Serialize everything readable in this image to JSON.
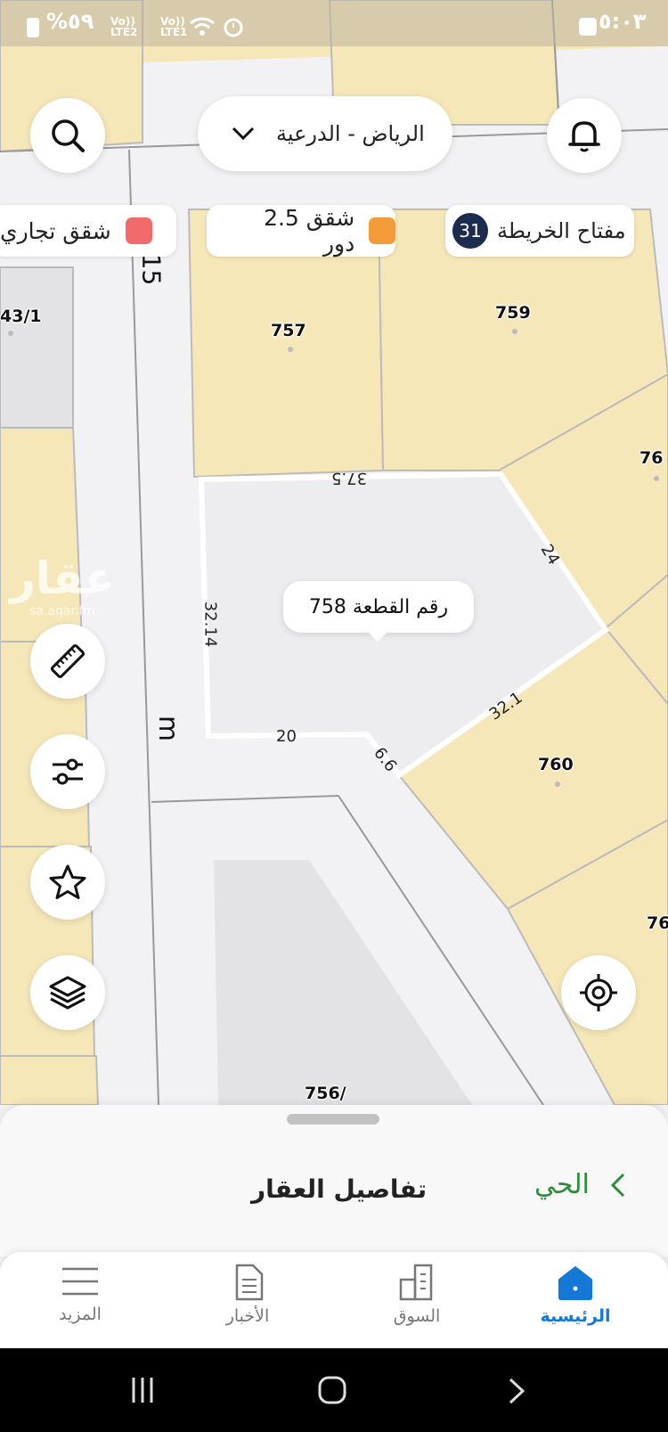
{
  "status_bar": {
    "time": "٥:٠٣",
    "battery": "%٥٩",
    "network_1": "Vo)) LTE2",
    "network_2": "Vo)) LTE1"
  },
  "header": {
    "location": "الرياض - الدرعية"
  },
  "legend_chips": {
    "map_key_label": "مفتاح الخريطة",
    "map_key_count": "31",
    "chip_1": {
      "label": "شقق 2.5 دور",
      "color": "#f29b38"
    },
    "chip_2": {
      "label": "شقق تجاري",
      "color": "#f26b6b"
    }
  },
  "map": {
    "street_labels": [
      "15",
      "m",
      "m"
    ],
    "plots": [
      "757",
      "759",
      "76",
      "760",
      "76",
      "756/",
      "43/1"
    ],
    "dimensions": [
      "37.5",
      "24",
      "32.14",
      "20",
      "6.6",
      "32.1"
    ],
    "selected_plot_label": "رقم القطعة 758",
    "watermark": "عقار",
    "watermark_sub": "sa.aqar.fm"
  },
  "bottom_sheet": {
    "title": "تفاصيل العقار",
    "link": "الحي"
  },
  "nav": {
    "home": "الرئيسية",
    "market": "السوق",
    "news": "الأخبار",
    "more": "المزيد"
  },
  "colors": {
    "plot_fill": "#f5e7b8",
    "selected_fill": "#ededf0",
    "brand_blue": "#1479d6",
    "link_green": "#2f8c3a"
  }
}
